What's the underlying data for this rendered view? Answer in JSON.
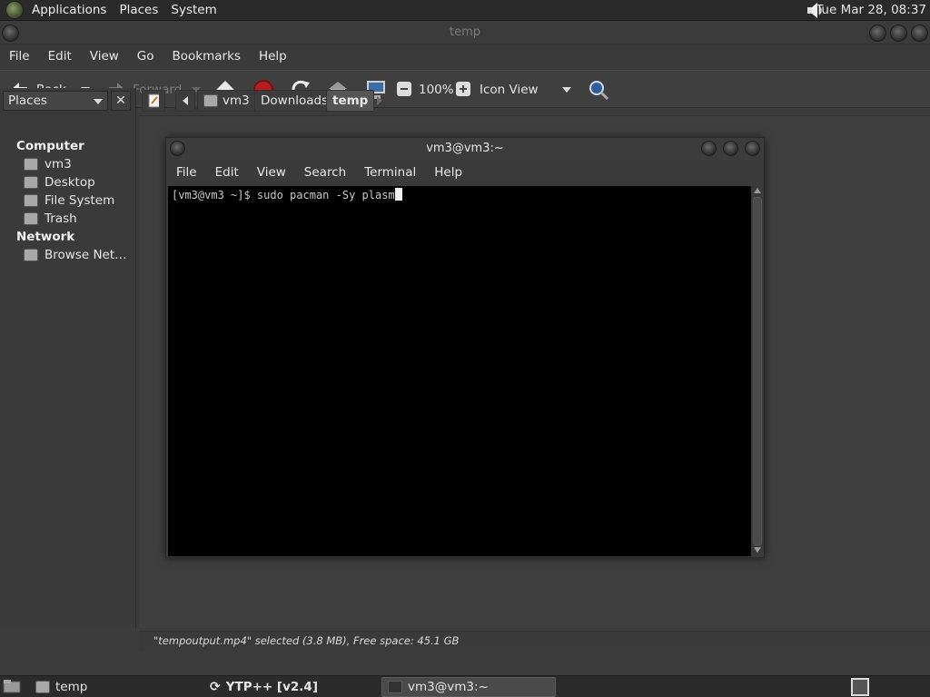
{
  "top_panel": {
    "menus": [
      "Applications",
      "Places",
      "System"
    ],
    "clock": "Tue Mar 28, 08:37",
    "icons": {
      "logo": "gnome-foot-icon",
      "volume": "speaker-volume-icon"
    }
  },
  "nautilus": {
    "title": "temp",
    "menu": [
      "File",
      "Edit",
      "View",
      "Go",
      "Bookmarks",
      "Help"
    ],
    "toolbar": {
      "back": "Back",
      "forward": "Forward",
      "zoom": "100%",
      "view_mode": "Icon View"
    },
    "sidebar": {
      "selector": "Places",
      "computer_heading": "Computer",
      "computer_items": [
        "vm3",
        "Desktop",
        "File System",
        "Trash"
      ],
      "network_heading": "Network",
      "network_items": [
        "Browse Net…"
      ]
    },
    "pathbar": [
      "vm3",
      "Downloads",
      "temp"
    ],
    "status": "\"tempoutput.mp4\" selected (3.8 MB), Free space: 45.1 GB"
  },
  "terminal": {
    "title": "vm3@vm3:~",
    "menu": [
      "File",
      "Edit",
      "View",
      "Search",
      "Terminal",
      "Help"
    ],
    "prompt": "[vm3@vm3 ~]$ ",
    "command": "sudo pacman -Sy plasm"
  },
  "taskbar": {
    "tasks": [
      "temp",
      "YTP++ [v2.4]",
      "vm3@vm3:~"
    ]
  },
  "colors": {
    "panel": "#2a2a2a",
    "window": "#3c3c3c",
    "terminal_bg": "#000000",
    "terminal_fg": "#c8c8c8"
  }
}
